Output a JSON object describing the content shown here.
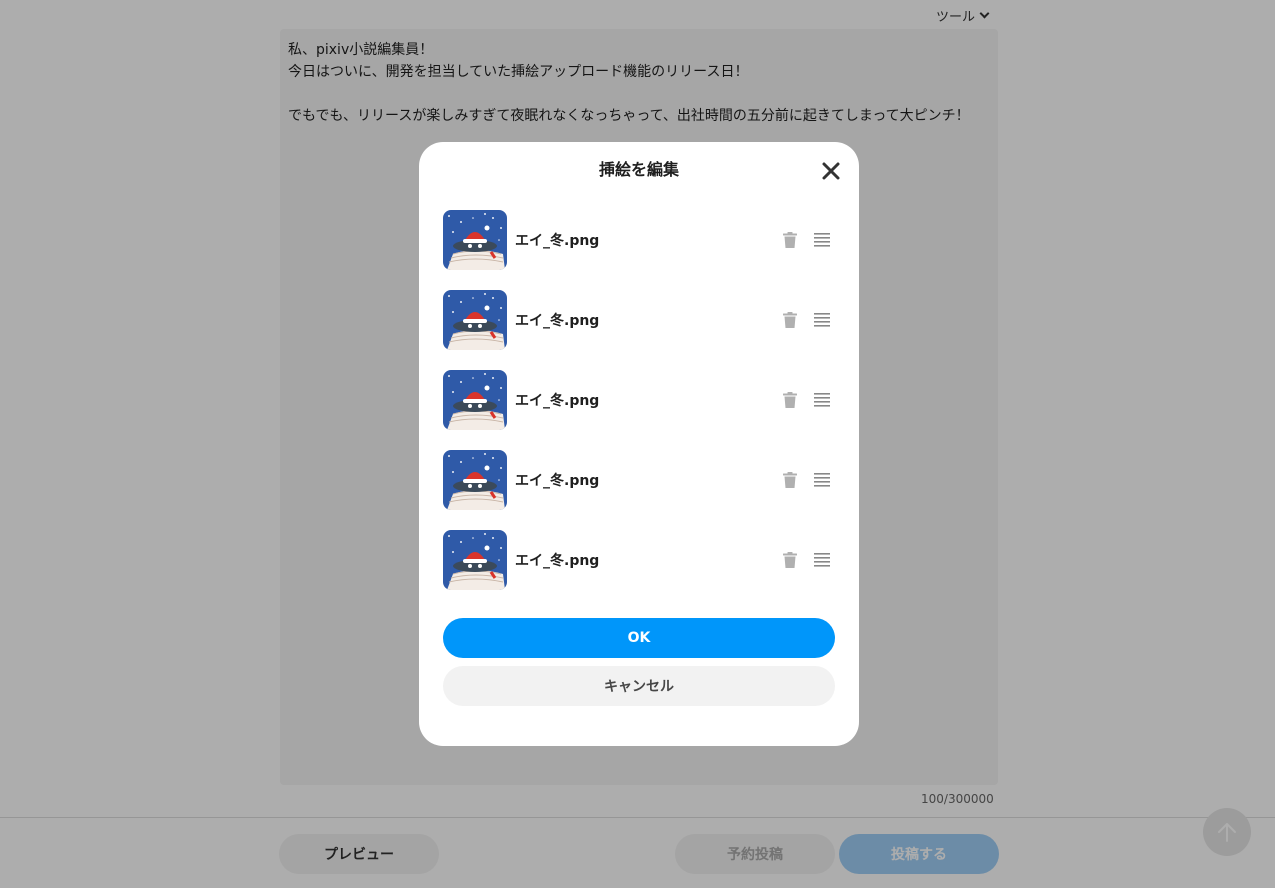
{
  "header": {
    "tools_label": "ツール"
  },
  "editor": {
    "lines": [
      "私、pixiv小説編集員！",
      "今日はついに、開発を担当していた挿絵アップロード機能のリリース日！",
      "",
      "でもでも、リリースが楽しみすぎて夜眠れなくなっちゃって、出社時間の五分前に起きてしまって大ピンチ！"
    ],
    "char_count": "100/300000"
  },
  "footer": {
    "preview_label": "プレビュー",
    "schedule_label": "予約投稿",
    "post_label": "投稿する"
  },
  "modal": {
    "title": "挿絵を編集",
    "items": [
      {
        "filename": "エイ_冬.png"
      },
      {
        "filename": "エイ_冬.png"
      },
      {
        "filename": "エイ_冬.png"
      },
      {
        "filename": "エイ_冬.png"
      },
      {
        "filename": "エイ_冬.png"
      }
    ],
    "ok_label": "OK",
    "cancel_label": "キャンセル"
  },
  "icons": {
    "close": "close-icon",
    "trash": "trash-icon",
    "drag": "drag-handle-icon",
    "scroll_top": "arrow-up-icon",
    "chevron": "chevron-down-icon"
  },
  "colors": {
    "primary": "#0096fa",
    "overlay": "rgba(0,0,0,0.32)"
  }
}
